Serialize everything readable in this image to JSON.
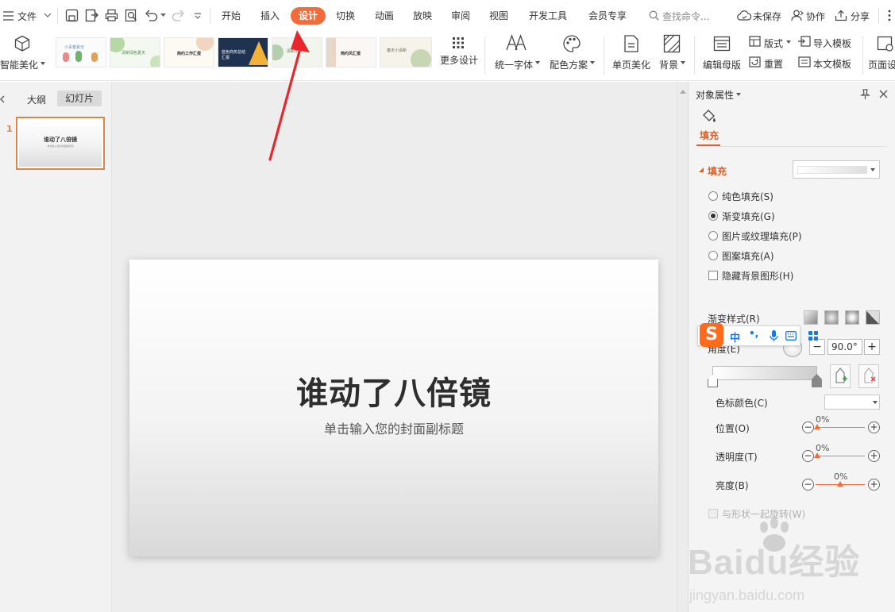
{
  "menubar": {
    "menu_label": "文件",
    "tabs": [
      {
        "label": "开始"
      },
      {
        "label": "插入"
      },
      {
        "label": "设计"
      },
      {
        "label": "切换"
      },
      {
        "label": "动画"
      },
      {
        "label": "放映"
      },
      {
        "label": "审阅"
      },
      {
        "label": "视图"
      },
      {
        "label": "开发工具"
      },
      {
        "label": "会员专享"
      }
    ],
    "active_tab": "设计",
    "search_placeholder": "查找命令...",
    "unsaved": "未保存",
    "collab": "协作",
    "share": "分享"
  },
  "ribbon": {
    "smart_beautify": "智能美化",
    "templates": [
      {
        "caption": "小青春夏日"
      },
      {
        "caption": "清新绿色夏天"
      },
      {
        "caption": "简约工作汇报"
      },
      {
        "caption": "蓝色商务总结汇报"
      },
      {
        "caption": "清新水彩"
      },
      {
        "caption": "简约风汇报"
      },
      {
        "caption": "春天小清新"
      }
    ],
    "more_design": "更多设计",
    "unify_font": "统一字体",
    "color_scheme": "配色方案",
    "single_page_beautify": "单页美化",
    "background": "背景",
    "edit_master": "编辑母版",
    "layout": "版式",
    "reset": "重置",
    "import_template": "导入模板",
    "this_template": "本文模板",
    "page_setup": "页面设"
  },
  "left_panel": {
    "outline_tab": "大纲",
    "slides_tab": "幻灯片",
    "slides": [
      {
        "number": "1"
      }
    ]
  },
  "slide": {
    "title": "谁动了八倍镜",
    "subtitle": "单击输入您的封面副标题"
  },
  "properties": {
    "header": "对象属性",
    "fill_tab": "填充",
    "fill_section": "填充",
    "options": [
      {
        "label": "纯色填充(S)",
        "selected": false
      },
      {
        "label": "渐变填充(G)",
        "selected": true
      },
      {
        "label": "图片或纹理填充(P)",
        "selected": false
      },
      {
        "label": "图案填充(A)",
        "selected": false
      }
    ],
    "hide_bg_label": "隐藏背景图形(H)",
    "gradient_style_label": "渐变样式(R)",
    "angle_label": "角度(E)",
    "angle_value": "90.0°",
    "stop_color_label": "色标颜色(C)",
    "position_label": "位置(O)",
    "position_value": "0%",
    "transparency_label": "透明度(T)",
    "transparency_value": "0%",
    "brightness_label": "亮度(B)",
    "brightness_value": "0%",
    "rotate_with_shape_label": "与形状一起旋转(W)"
  },
  "ime_toolbar": {
    "mode": "中",
    "punct": "•,"
  },
  "watermark": {
    "brand": "Baidu经验",
    "url": "jingyan.baidu.com"
  },
  "colors": {
    "accent": "#f26b3a",
    "annotation_arrow": "#e8262c",
    "ime_blue": "#1577e8",
    "slide_thumb_border": "#d9874a"
  }
}
